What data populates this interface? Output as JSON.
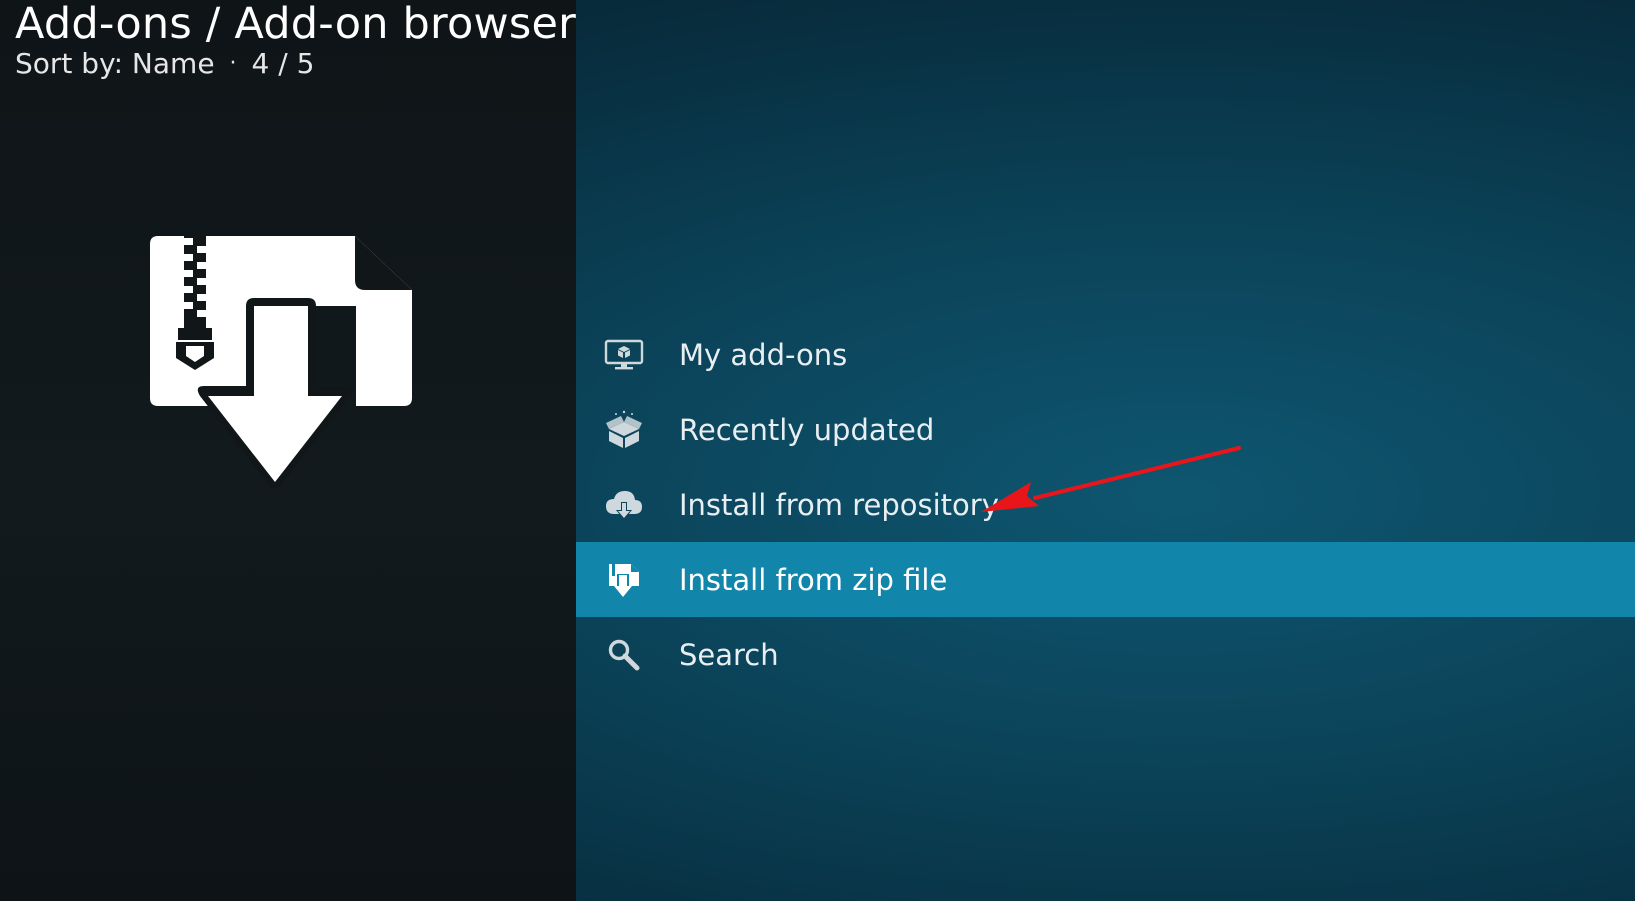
{
  "header": {
    "title": "Add-ons / Add-on browser",
    "sort_label": "Sort by: Name",
    "separator": "·",
    "position": "4 / 5"
  },
  "preview": {
    "icon": "zip-download-icon"
  },
  "menu": {
    "items": [
      {
        "label": "My add-ons",
        "icon": "monitor-box-icon",
        "focused": false
      },
      {
        "label": "Recently updated",
        "icon": "open-box-icon",
        "focused": false
      },
      {
        "label": "Install from repository",
        "icon": "cloud-download-icon",
        "focused": false
      },
      {
        "label": "Install from zip file",
        "icon": "zip-file-download-icon",
        "focused": true
      },
      {
        "label": "Search",
        "icon": "search-icon",
        "focused": false
      }
    ]
  },
  "annotation": {
    "type": "red-arrow",
    "color": "#e8161b",
    "points_to": "Install from repository"
  },
  "colors": {
    "focus_bar": "#1186aa",
    "left_panel": "#111719",
    "background": "#0b4359"
  }
}
